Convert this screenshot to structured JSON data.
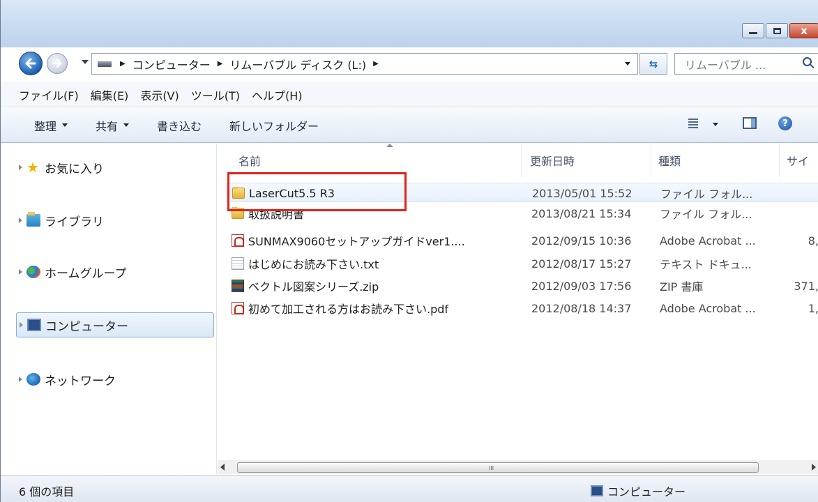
{
  "title_bar": {
    "minimize_label": "",
    "maximize_label": "",
    "close_label": "x"
  },
  "address_bar": {
    "crumbs": [
      "コンピューター",
      "リムーバブル ディスク (L:)"
    ],
    "search_placeholder": "リムーバブル ..."
  },
  "menu": [
    "ファイル(F)",
    "編集(E)",
    "表示(V)",
    "ツール(T)",
    "ヘルプ(H)"
  ],
  "commands": {
    "organize": "整理",
    "share": "共有",
    "burn": "書き込む",
    "new_folder": "新しいフォルダー"
  },
  "nav_pane": {
    "favorites": "お気に入り",
    "libraries": "ライブラリ",
    "homegroup": "ホームグループ",
    "computer": "コンピューター",
    "network": "ネットワーク"
  },
  "columns": {
    "name": "名前",
    "date": "更新日時",
    "type": "種類",
    "size": "サイ"
  },
  "files": [
    {
      "name": "LaserCut5.5 R3",
      "date": "2013/05/01 15:52",
      "type": "ファイル フォル...",
      "size": "",
      "icon": "folder-icon"
    },
    {
      "name": "取扱説明書",
      "date": "2013/08/21 15:34",
      "type": "ファイル フォル...",
      "size": "",
      "icon": "folder-icon"
    },
    {
      "name": "SUNMAX9060セットアップガイドver1....",
      "date": "2012/09/15 10:36",
      "type": "Adobe Acrobat ...",
      "size": "8,",
      "icon": "pdf-icon"
    },
    {
      "name": "はじめにお読み下さい.txt",
      "date": "2012/08/17 15:27",
      "type": "テキスト ドキュ...",
      "size": "",
      "icon": "text-file-icon"
    },
    {
      "name": "ベクトル図案シリーズ.zip",
      "date": "2012/09/03 17:56",
      "type": "ZIP 書庫",
      "size": "371,",
      "icon": "zip-icon"
    },
    {
      "name": "初めて加工される方はお読み下さい.pdf",
      "date": "2012/08/18 14:37",
      "type": "Adobe Acrobat ...",
      "size": "1,",
      "icon": "pdf-icon"
    }
  ],
  "scrollbar": {
    "grip": "III"
  },
  "status_bar": {
    "item_count": "6 個の項目",
    "location": "コンピューター"
  },
  "colors": {
    "highlight": "#e2231a",
    "selection": "#dae8f8",
    "titlebar": "#c9dcf1"
  }
}
